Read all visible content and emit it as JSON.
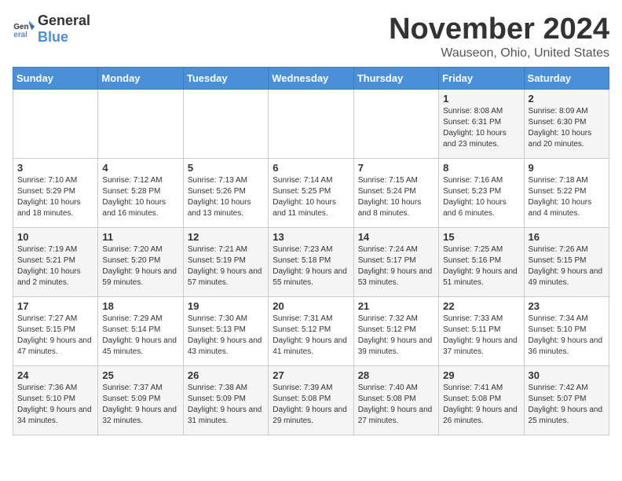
{
  "header": {
    "logo_general": "General",
    "logo_blue": "Blue",
    "title": "November 2024",
    "subtitle": "Wauseon, Ohio, United States"
  },
  "weekdays": [
    "Sunday",
    "Monday",
    "Tuesday",
    "Wednesday",
    "Thursday",
    "Friday",
    "Saturday"
  ],
  "weeks": [
    [
      {
        "day": "",
        "info": ""
      },
      {
        "day": "",
        "info": ""
      },
      {
        "day": "",
        "info": ""
      },
      {
        "day": "",
        "info": ""
      },
      {
        "day": "",
        "info": ""
      },
      {
        "day": "1",
        "info": "Sunrise: 8:08 AM\nSunset: 6:31 PM\nDaylight: 10 hours and 23 minutes."
      },
      {
        "day": "2",
        "info": "Sunrise: 8:09 AM\nSunset: 6:30 PM\nDaylight: 10 hours and 20 minutes."
      }
    ],
    [
      {
        "day": "3",
        "info": "Sunrise: 7:10 AM\nSunset: 5:29 PM\nDaylight: 10 hours and 18 minutes."
      },
      {
        "day": "4",
        "info": "Sunrise: 7:12 AM\nSunset: 5:28 PM\nDaylight: 10 hours and 16 minutes."
      },
      {
        "day": "5",
        "info": "Sunrise: 7:13 AM\nSunset: 5:26 PM\nDaylight: 10 hours and 13 minutes."
      },
      {
        "day": "6",
        "info": "Sunrise: 7:14 AM\nSunset: 5:25 PM\nDaylight: 10 hours and 11 minutes."
      },
      {
        "day": "7",
        "info": "Sunrise: 7:15 AM\nSunset: 5:24 PM\nDaylight: 10 hours and 8 minutes."
      },
      {
        "day": "8",
        "info": "Sunrise: 7:16 AM\nSunset: 5:23 PM\nDaylight: 10 hours and 6 minutes."
      },
      {
        "day": "9",
        "info": "Sunrise: 7:18 AM\nSunset: 5:22 PM\nDaylight: 10 hours and 4 minutes."
      }
    ],
    [
      {
        "day": "10",
        "info": "Sunrise: 7:19 AM\nSunset: 5:21 PM\nDaylight: 10 hours and 2 minutes."
      },
      {
        "day": "11",
        "info": "Sunrise: 7:20 AM\nSunset: 5:20 PM\nDaylight: 9 hours and 59 minutes."
      },
      {
        "day": "12",
        "info": "Sunrise: 7:21 AM\nSunset: 5:19 PM\nDaylight: 9 hours and 57 minutes."
      },
      {
        "day": "13",
        "info": "Sunrise: 7:23 AM\nSunset: 5:18 PM\nDaylight: 9 hours and 55 minutes."
      },
      {
        "day": "14",
        "info": "Sunrise: 7:24 AM\nSunset: 5:17 PM\nDaylight: 9 hours and 53 minutes."
      },
      {
        "day": "15",
        "info": "Sunrise: 7:25 AM\nSunset: 5:16 PM\nDaylight: 9 hours and 51 minutes."
      },
      {
        "day": "16",
        "info": "Sunrise: 7:26 AM\nSunset: 5:15 PM\nDaylight: 9 hours and 49 minutes."
      }
    ],
    [
      {
        "day": "17",
        "info": "Sunrise: 7:27 AM\nSunset: 5:15 PM\nDaylight: 9 hours and 47 minutes."
      },
      {
        "day": "18",
        "info": "Sunrise: 7:29 AM\nSunset: 5:14 PM\nDaylight: 9 hours and 45 minutes."
      },
      {
        "day": "19",
        "info": "Sunrise: 7:30 AM\nSunset: 5:13 PM\nDaylight: 9 hours and 43 minutes."
      },
      {
        "day": "20",
        "info": "Sunrise: 7:31 AM\nSunset: 5:12 PM\nDaylight: 9 hours and 41 minutes."
      },
      {
        "day": "21",
        "info": "Sunrise: 7:32 AM\nSunset: 5:12 PM\nDaylight: 9 hours and 39 minutes."
      },
      {
        "day": "22",
        "info": "Sunrise: 7:33 AM\nSunset: 5:11 PM\nDaylight: 9 hours and 37 minutes."
      },
      {
        "day": "23",
        "info": "Sunrise: 7:34 AM\nSunset: 5:10 PM\nDaylight: 9 hours and 36 minutes."
      }
    ],
    [
      {
        "day": "24",
        "info": "Sunrise: 7:36 AM\nSunset: 5:10 PM\nDaylight: 9 hours and 34 minutes."
      },
      {
        "day": "25",
        "info": "Sunrise: 7:37 AM\nSunset: 5:09 PM\nDaylight: 9 hours and 32 minutes."
      },
      {
        "day": "26",
        "info": "Sunrise: 7:38 AM\nSunset: 5:09 PM\nDaylight: 9 hours and 31 minutes."
      },
      {
        "day": "27",
        "info": "Sunrise: 7:39 AM\nSunset: 5:08 PM\nDaylight: 9 hours and 29 minutes."
      },
      {
        "day": "28",
        "info": "Sunrise: 7:40 AM\nSunset: 5:08 PM\nDaylight: 9 hours and 27 minutes."
      },
      {
        "day": "29",
        "info": "Sunrise: 7:41 AM\nSunset: 5:08 PM\nDaylight: 9 hours and 26 minutes."
      },
      {
        "day": "30",
        "info": "Sunrise: 7:42 AM\nSunset: 5:07 PM\nDaylight: 9 hours and 25 minutes."
      }
    ]
  ]
}
